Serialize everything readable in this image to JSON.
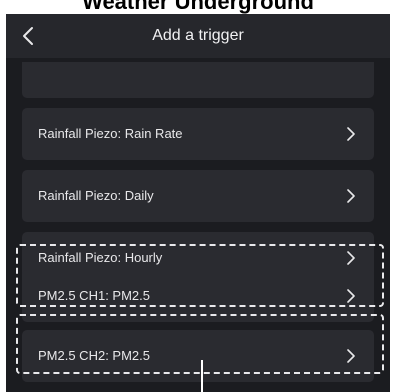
{
  "annotation": {
    "clipped_heading": "Weather Underground"
  },
  "header": {
    "title": "Add a trigger",
    "back_icon": "chevron-left-icon"
  },
  "triggers": [
    {
      "label": "Rainfall Piezo: Rain Rate",
      "icon": "chevron-right-icon",
      "highlighted": false
    },
    {
      "label": "Rainfall Piezo: Daily",
      "icon": "chevron-right-icon",
      "highlighted": false
    },
    {
      "label": "Rainfall Piezo: Hourly",
      "icon": "chevron-right-icon",
      "highlighted": false
    },
    {
      "label": "PM2.5 CH1: PM2.5",
      "icon": "chevron-right-icon",
      "highlighted": true
    },
    {
      "label": "PM2.5 CH2: PM2.5",
      "icon": "chevron-right-icon",
      "highlighted": true
    }
  ],
  "colors": {
    "screen_background": "#1b1c20",
    "header_background": "#26272c",
    "card_background": "#2a2b30",
    "text": "#e8e8ea",
    "highlight_dash": "#e9e9ec"
  }
}
